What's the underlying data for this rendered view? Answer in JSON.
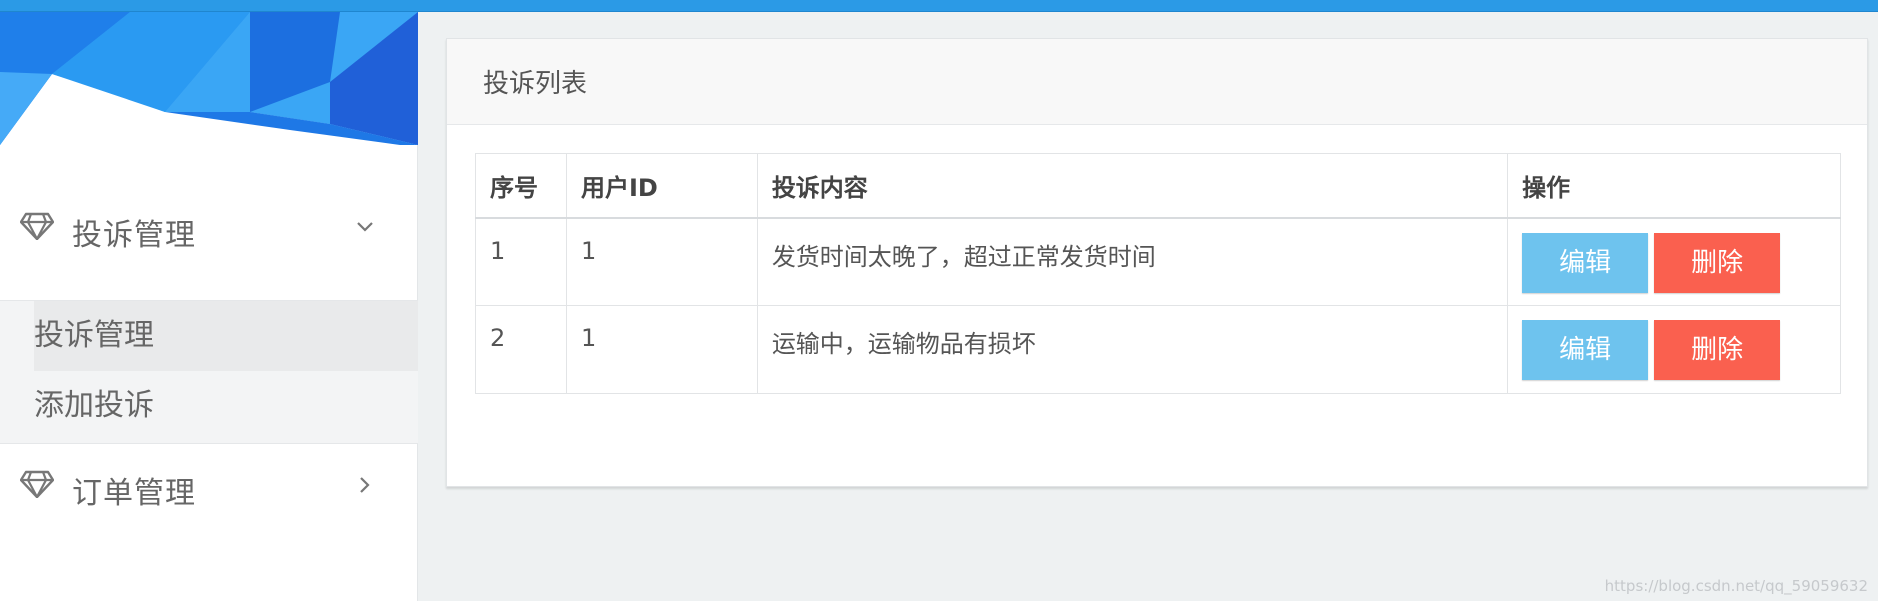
{
  "sidebar": {
    "groups": [
      {
        "label": "投诉管理",
        "expanded": true
      },
      {
        "label": "订单管理",
        "expanded": false
      }
    ],
    "submenu": [
      {
        "label": "投诉管理",
        "active": true
      },
      {
        "label": "添加投诉",
        "active": false
      }
    ]
  },
  "panel": {
    "title": "投诉列表"
  },
  "table": {
    "columns": [
      "序号",
      "用户ID",
      "投诉内容",
      "操作"
    ],
    "rows": [
      {
        "index": "1",
        "user_id": "1",
        "content": "发货时间太晚了，超过正常发货时间"
      },
      {
        "index": "2",
        "user_id": "1",
        "content": "运输中，运输物品有损坏"
      }
    ],
    "edit_label": "编辑",
    "delete_label": "删除"
  },
  "watermark": "https://blog.csdn.net/qq_59059632",
  "colors": {
    "topbar": "#2b9ae6",
    "edit_button": "#6ec3ee",
    "delete_button": "#fa604f"
  }
}
